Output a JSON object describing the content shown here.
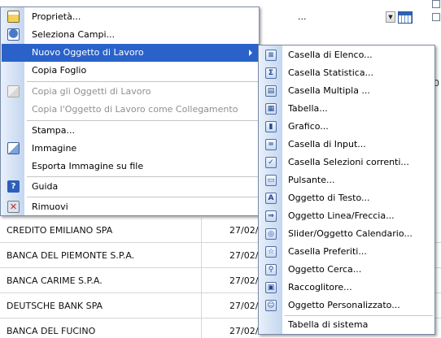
{
  "background": {
    "select_value": "...",
    "rows": [
      {
        "name": "CREDITO EMILIANO SPA",
        "date": "27/02/"
      },
      {
        "name": "BANCA DEL PIEMONTE S.P.A.",
        "date": "27/02/"
      },
      {
        "name": "BANCA CARIME S.P.A.",
        "date": "27/02/"
      },
      {
        "name": "DEUTSCHE BANK SPA",
        "date": "27/02/"
      },
      {
        "name": "BANCA DEL FUCINO",
        "date": "27/02/"
      }
    ],
    "right_hint": "0"
  },
  "context_menu": {
    "items": [
      {
        "label": "Proprietà...",
        "icon": "properties-icon",
        "disabled": false
      },
      {
        "label": "Seleziona Campi...",
        "icon": "select-fields-icon",
        "disabled": false
      },
      {
        "label": "Nuovo Oggetto di Lavoro",
        "icon": "",
        "disabled": false,
        "active": true,
        "has_submenu": true
      },
      {
        "label": "Copia Foglio",
        "icon": "",
        "disabled": false
      },
      {
        "label": "Copia gli Oggetti di Lavoro",
        "icon": "copy-icon",
        "disabled": true
      },
      {
        "label": "Copia l'Oggetto di Lavoro come Collegamento",
        "icon": "",
        "disabled": true
      },
      {
        "label": "Stampa...",
        "icon": "",
        "disabled": false
      },
      {
        "label": "Immagine",
        "icon": "image-icon",
        "disabled": false
      },
      {
        "label": "Esporta Immagine su file",
        "icon": "",
        "disabled": false
      },
      {
        "label": "Guida",
        "icon": "help-icon",
        "disabled": false
      },
      {
        "label": "Rimuovi",
        "icon": "remove-icon",
        "disabled": false
      }
    ]
  },
  "submenu": {
    "items": [
      {
        "label": "Casella di Elenco...",
        "icon": "list-box-icon",
        "glyph": "≡"
      },
      {
        "label": "Casella Statistica...",
        "icon": "statistics-box-icon",
        "glyph": "Σ"
      },
      {
        "label": "Casella Multipla ...",
        "icon": "multi-box-icon",
        "glyph": "▤"
      },
      {
        "label": "Tabella...",
        "icon": "table-icon",
        "glyph": "▦"
      },
      {
        "label": "Grafico...",
        "icon": "chart-icon",
        "glyph": "▮"
      },
      {
        "label": "Casella di Input...",
        "icon": "input-box-icon",
        "glyph": "="
      },
      {
        "label": "Casella Selezioni correnti...",
        "icon": "current-selections-icon",
        "glyph": "✓"
      },
      {
        "label": "Pulsante...",
        "icon": "button-icon",
        "glyph": "▭"
      },
      {
        "label": "Oggetto di Testo...",
        "icon": "text-object-icon",
        "glyph": "A"
      },
      {
        "label": "Oggetto Linea/Freccia...",
        "icon": "line-arrow-icon",
        "glyph": "⇒"
      },
      {
        "label": "Slider/Oggetto Calendario...",
        "icon": "slider-calendar-icon",
        "glyph": "◎"
      },
      {
        "label": "Casella Preferiti...",
        "icon": "bookmark-box-icon",
        "glyph": "☆"
      },
      {
        "label": "Oggetto Cerca...",
        "icon": "search-object-icon",
        "glyph": "⚲"
      },
      {
        "label": "Raccoglitore...",
        "icon": "container-icon",
        "glyph": "▣"
      },
      {
        "label": "Oggetto Personalizzato...",
        "icon": "custom-object-icon",
        "glyph": "☺"
      },
      {
        "label": "Tabella di sistema",
        "icon": "",
        "glyph": ""
      }
    ]
  }
}
